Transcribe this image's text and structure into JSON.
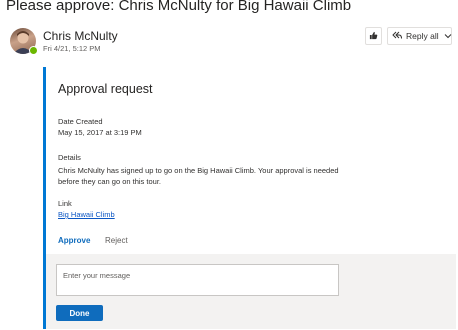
{
  "email": {
    "subject": "Please approve: Chris McNulty for Big Hawaii Climb",
    "sender_name": "Chris McNulty",
    "sent_date": "Fri 4/21, 5:12 PM",
    "presence_color": "#6bb700"
  },
  "toolbar": {
    "like_icon": "thumbs-up-icon",
    "reply_all_icon": "reply-all-icon",
    "reply_all_label": "Reply all",
    "more_icon": "chevron-down-icon"
  },
  "card": {
    "title": "Approval request",
    "date_created_label": "Date Created",
    "date_created_value": "May 15, 2017 at 3:19 PM",
    "details_label": "Details",
    "details_value": "Chris McNulty has signed up to go on the Big Hawaii Climb. Your approval is needed before they can go on this tour.",
    "link_label": "Link",
    "link_value": "Big Hawaii Climb",
    "approve_label": "Approve",
    "reject_label": "Reject",
    "accent_color": "#0078d4"
  },
  "reply": {
    "placeholder": "Enter your message",
    "done_label": "Done"
  }
}
